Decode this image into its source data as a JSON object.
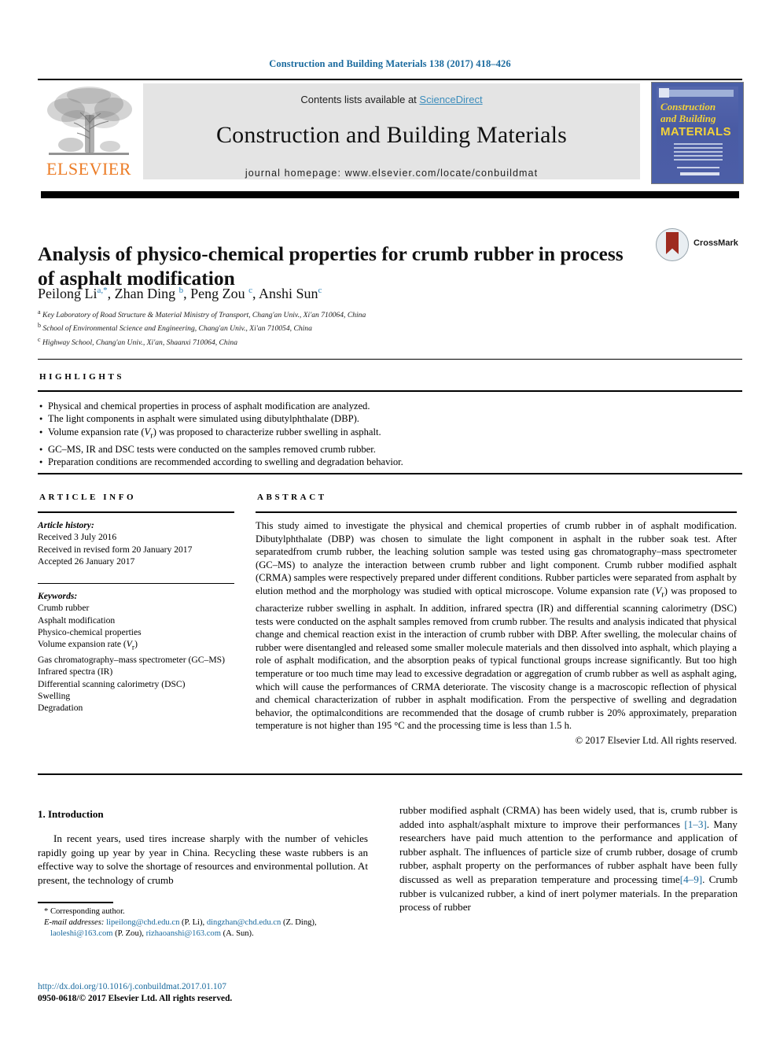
{
  "running_head": "Construction and Building Materials 138 (2017) 418–426",
  "masthead": {
    "elsevier_wordmark": "ELSEVIER",
    "contents_prefix": "Contents lists available at ",
    "sciencedirect": "ScienceDirect",
    "journal_title": "Construction and Building Materials",
    "homepage": "journal homepage: www.elsevier.com/locate/conbuildmat",
    "cover": {
      "line1": "Construction",
      "line2": "and Building",
      "line3": "MATERIALS"
    },
    "colors": {
      "link_blue": "#3c8dbc",
      "running_head_blue": "#1a6a9e",
      "elsevier_orange": "#ec7c26",
      "band_gray": "#e4e4e4",
      "cover_blue": "#4a5fa8",
      "cover_yellow": "#f2d23a"
    }
  },
  "article": {
    "title": "Analysis of physico-chemical properties for crumb rubber in process of asphalt modification",
    "crossmark_label": "CrossMark",
    "authors_html": "Peilong Li<sup>a,</sup><sup class=\"star\">*</sup>, Zhan Ding <sup>b</sup>, Peng Zou <sup>c</sup>, Anshi Sun<sup>c</sup>",
    "affiliations": [
      {
        "marker": "a",
        "text": "Key Laboratory of Road Structure & Material Ministry of Transport, Chang'an Univ., Xi'an 710064, China"
      },
      {
        "marker": "b",
        "text": "School of Environmental Science and Engineering, Chang'an Univ., Xi'an 710054, China"
      },
      {
        "marker": "c",
        "text": "Highway School, Chang'an Univ., Xi'an, Shaanxi 710064, China"
      }
    ]
  },
  "highlights": {
    "label": "HIGHLIGHTS",
    "items": [
      "Physical and chemical properties in process of asphalt modification are analyzed.",
      "The light components in asphalt were simulated using dibutylphthalate (DBP).",
      "Volume expansion rate (Vr) was proposed to characterize rubber swelling in asphalt.",
      "GC–MS, IR and DSC tests were conducted on the samples removed crumb rubber.",
      "Preparation conditions are recommended according to swelling and degradation behavior."
    ]
  },
  "article_info": {
    "label": "ARTICLE INFO",
    "history_head": "Article history:",
    "history": [
      "Received 3 July 2016",
      "Received in revised form 20 January 2017",
      "Accepted 26 January 2017"
    ],
    "keywords_head": "Keywords:",
    "keywords": [
      "Crumb rubber",
      "Asphalt modification",
      "Physico-chemical properties",
      "Volume expansion rate (Vr)",
      "Gas chromatography–mass spectrometer (GC–MS)",
      "Infrared spectra (IR)",
      "Differential scanning calorimetry (DSC)",
      "Swelling",
      "Degradation"
    ]
  },
  "abstract": {
    "label": "ABSTRACT",
    "text": "This study aimed to investigate the physical and chemical properties of crumb rubber in of asphalt modification. Dibutylphthalate (DBP) was chosen to simulate the light component in asphalt in the rubber soak test. After separatedfrom crumb rubber, the leaching solution sample was tested using gas chromatography–mass spectrometer (GC–MS) to analyze the interaction between crumb rubber and light component. Crumb rubber modified asphalt (CRMA) samples were respectively prepared under different conditions. Rubber particles were separated from asphalt by elution method and the morphology was studied with optical microscope. Volume expansion rate (Vr) was proposed to characterize rubber swelling in asphalt. In addition, infrared spectra (IR) and differential scanning calorimetry (DSC) tests were conducted on the asphalt samples removed from crumb rubber. The results and analysis indicated that physical change and chemical reaction exist in the interaction of crumb rubber with DBP. After swelling, the molecular chains of rubber were disentangled and released some smaller molecule materials and then dissolved into asphalt, which playing a role of asphalt modification, and the absorption peaks of typical functional groups increase significantly. But too high temperature or too much time may lead to excessive degradation or aggregation of crumb rubber as well as asphalt aging, which will cause the performances of CRMA deteriorate. The viscosity change is a macroscopic reflection of physical and chemical characterization of rubber in asphalt modification. From the perspective of swelling and degradation behavior, the optimalconditions are recommended that the dosage of crumb rubber is 20% approximately, preparation temperature is not higher than 195 °C and the processing time is less than 1.5 h.",
    "copyright": "© 2017 Elsevier Ltd. All rights reserved."
  },
  "body": {
    "section_heading": "1. Introduction",
    "left_paragraph": "In recent years, used tires increase sharply with the number of vehicles rapidly going up year by year in China. Recycling these waste rubbers is an effective way to solve the shortage of resources and environmental pollution. At present, the technology of crumb",
    "right_paragraph_html": "rubber modified asphalt (CRMA) has been widely used, that is, crumb rubber is added into asphalt/asphalt mixture to improve their performances <span class=\"ref\">[1–3]</span>. Many researchers have paid much attention to the performance and application of rubber asphalt. The influences of particle size of crumb rubber, dosage of crumb rubber, asphalt property on the performances of rubber asphalt have been fully discussed as well as preparation temperature and processing time<span class=\"ref\">[4–9]</span>. Crumb rubber is vulcanized rubber, a kind of inert polymer materials. In the preparation process of rubber"
  },
  "footer": {
    "corresponding": "* Corresponding author.",
    "email_label": "E-mail addresses:",
    "emails_html": "<span class=\"lnk\">lipeilong@chd.edu.cn</span> (P. Li), <span class=\"lnk\">dingzhan@chd.edu.cn</span> (Z. Ding), <span class=\"lnk\">laoleshi@163.com</span> (P. Zou), <span class=\"lnk\">rizhaoanshi@163.com</span> (A. Sun).",
    "doi": "http://dx.doi.org/10.1016/j.conbuildmat.2017.01.107",
    "issn_line": "0950-0618/© 2017 Elsevier Ltd. All rights reserved."
  }
}
